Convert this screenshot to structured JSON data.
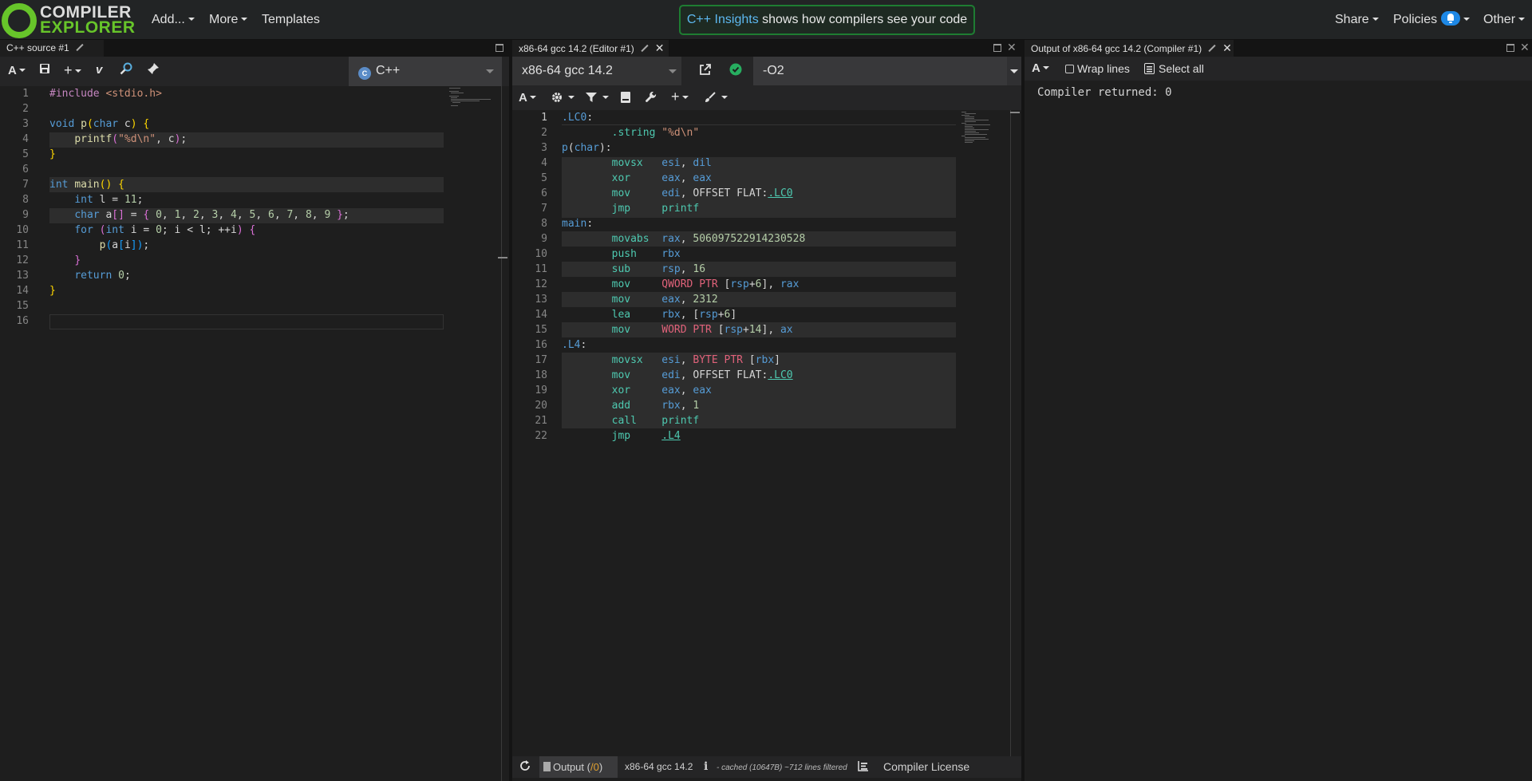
{
  "nav": {
    "logo_line1": "COMPILER",
    "logo_line2": "EXPLORER",
    "add": "Add...",
    "more": "More",
    "templates": "Templates",
    "insights_highlight": "C++ Insights",
    "insights_rest": " shows how compilers see your code",
    "share": "Share",
    "policies": "Policies",
    "other": "Other"
  },
  "source": {
    "tab_title": "C++ source #1",
    "language": "C++",
    "lines": [
      "1",
      "2",
      "3",
      "4",
      "5",
      "6",
      "7",
      "8",
      "9",
      "10",
      "11",
      "12",
      "13",
      "14",
      "15",
      "16"
    ]
  },
  "compiler": {
    "tab_title": "x86-64 gcc 14.2 (Editor #1)",
    "name": "x86-64 gcc 14.2",
    "options": "-O2",
    "lines": [
      "1",
      "2",
      "3",
      "4",
      "5",
      "6",
      "7",
      "8",
      "9",
      "10",
      "11",
      "12",
      "13",
      "14",
      "15",
      "16",
      "17",
      "18",
      "19",
      "20",
      "21",
      "22"
    ],
    "asm": {
      "l1_label": ".LC0",
      "l2_op": ".string",
      "l2_arg": "\"%d\\n\"",
      "l3_label": "p",
      "l3_type": "char",
      "l9_imm": "506097522914230528"
    }
  },
  "bottom": {
    "output_label": "Output (",
    "output_count": "/0",
    "output_close": ")",
    "compiler_name": "x86-64 gcc 14.2",
    "cache_info": "- cached (10647B) ~712 lines filtered",
    "license": "Compiler License"
  },
  "output": {
    "tab_title": "Output of x86-64 gcc 14.2 (Compiler #1)",
    "wrap_lines": "Wrap lines",
    "select_all": "Select all",
    "result": "Compiler returned: 0"
  },
  "colors": {
    "accent_green": "#67c52a",
    "insights_border": "#1e7d32",
    "bell_blue": "#1e88e5",
    "ok_green": "#27ae60"
  }
}
